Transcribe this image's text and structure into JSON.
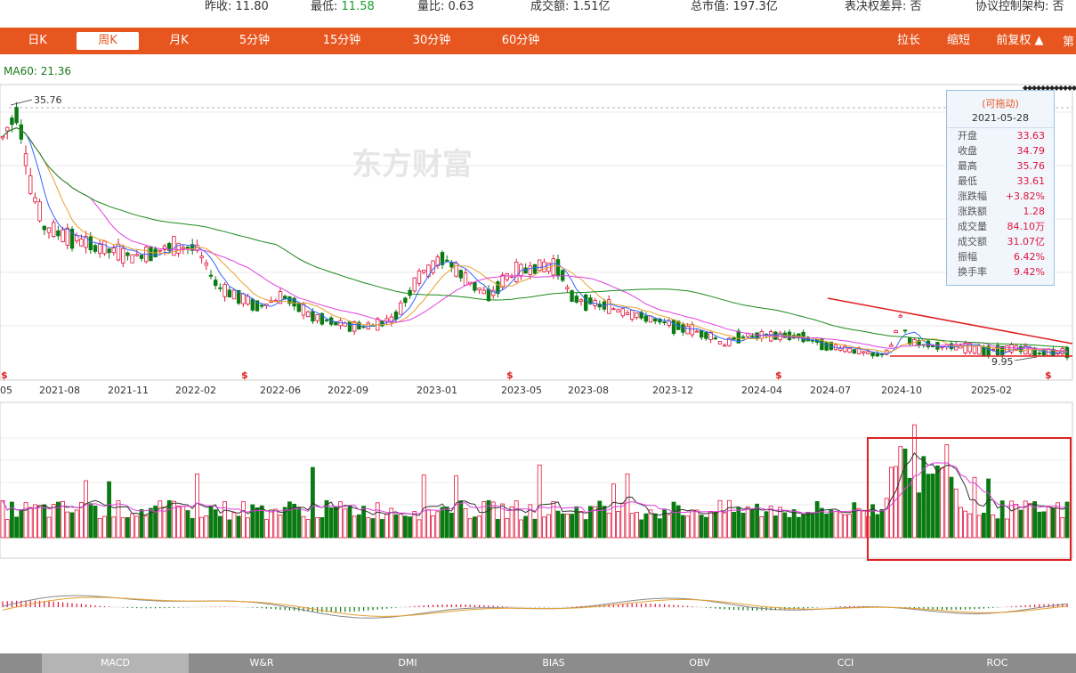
{
  "stats": [
    {
      "label": "昨收:",
      "value": "11.80",
      "color": ""
    },
    {
      "label": "最低:",
      "value": "11.58",
      "color": "green"
    },
    {
      "label": "量比:",
      "value": "0.63",
      "color": ""
    },
    {
      "label": "成交额:",
      "value": "1.51亿",
      "color": ""
    },
    {
      "label": "总市值:",
      "value": "197.3亿",
      "color": ""
    },
    {
      "label": "表决权差异:",
      "value": "否",
      "color": ""
    },
    {
      "label": "协议控制架构:",
      "value": "否",
      "color": ""
    }
  ],
  "periods": [
    "日K",
    "周K",
    "月K",
    "5分钟",
    "15分钟",
    "30分钟",
    "60分钟"
  ],
  "active_period": "周K",
  "right_actions": [
    "拉长",
    "缩短",
    "前复权 ▲"
  ],
  "right_marker": "第",
  "ma_label": "MA60: 21.36",
  "watermark": "东方财富",
  "price_high": "35.76",
  "price_low": "9.95",
  "x_dates": [
    "05",
    "2021-08",
    "2021-11",
    "2022-02",
    "2022-06",
    "2022-09",
    "2023-01",
    "2023-05",
    "2023-08",
    "2023-12",
    "2024-04",
    "2024-07",
    "2024-10",
    "2025-02"
  ],
  "tooltip": {
    "header": "(可拖动)",
    "date": "2021-05-28",
    "rows": [
      {
        "k": "开盘",
        "v": "33.63"
      },
      {
        "k": "收盘",
        "v": "34.79"
      },
      {
        "k": "最高",
        "v": "35.76"
      },
      {
        "k": "最低",
        "v": "33.61"
      },
      {
        "k": "涨跌幅",
        "v": "+3.82%"
      },
      {
        "k": "涨跌额",
        "v": "1.28"
      },
      {
        "k": "成交量",
        "v": "84.10万"
      },
      {
        "k": "成交额",
        "v": "31.07亿"
      },
      {
        "k": "振幅",
        "v": "6.42%"
      },
      {
        "k": "换手率",
        "v": "9.42%"
      }
    ]
  },
  "indicator_tabs": [
    "MACD",
    "W&R",
    "DMI",
    "BIAS",
    "OBV",
    "CCI",
    "ROC"
  ],
  "active_indicator": "MACD",
  "colors": {
    "brand": "#e8561f",
    "up": "#e0143c",
    "down": "#0a7a12",
    "ma5": "#3366ff",
    "ma10": "#e8a030",
    "ma20": "#e040e0",
    "ma60": "#1a8a1a"
  }
}
